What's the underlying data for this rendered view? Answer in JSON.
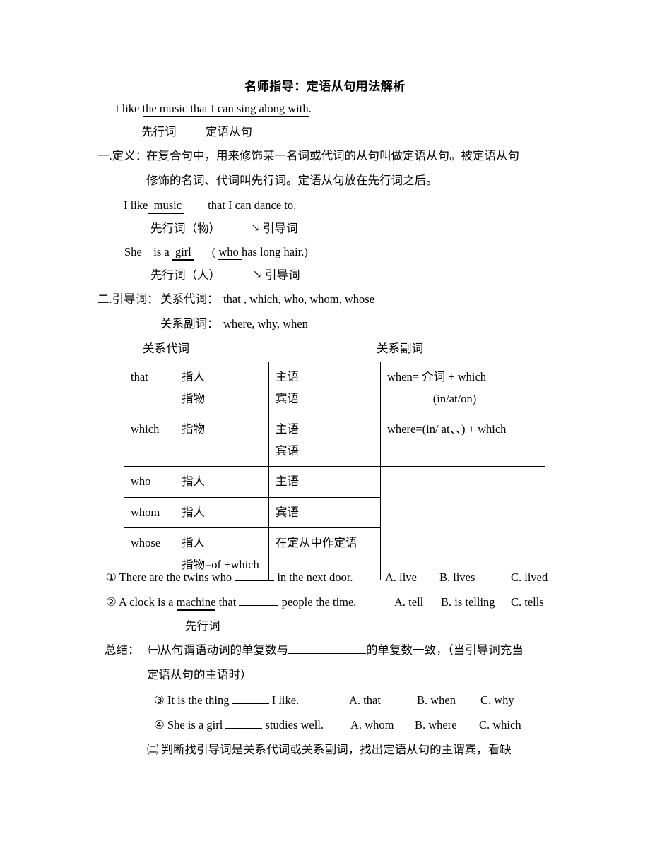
{
  "document": {
    "title": "名师指导：定语从句用法解析"
  },
  "example1": {
    "prefix": "I like ",
    "antecedent": "the music",
    "clause": " that I can sing along with",
    "period": ".",
    "label_antecedent": "先行词",
    "label_clause": "定语从句"
  },
  "definition": {
    "heading": "一.定义：",
    "line1": "在复合句中，用来修饰某一名词或代词的从句叫做定语从句。被定语从句",
    "line2": "修饰的名词、代词叫先行词。定语从句放在先行词之后。"
  },
  "example2": {
    "prefix": "I like",
    "antecedent": "  music ",
    "mid": "        ",
    "relword": "that",
    "rest": " I can dance to.",
    "label_antecedent": "先行词（物）",
    "arrow": "↘",
    "label_relword": "引导词"
  },
  "example3": {
    "prefix": "She    is a ",
    "antecedent": " girl ",
    "mid": "      ( ",
    "relword": "who ",
    "rest": "has long hair.)",
    "label_antecedent": "先行词（人）",
    "arrow": "↘",
    "label_relword": "引导词"
  },
  "guidewords": {
    "heading": "二.引导词：",
    "pronoun_label": "关系代词：",
    "pronoun_list": "that , which, who, whom, whose",
    "adverb_label": "关系副词：",
    "adverb_list": "where, why, when"
  },
  "table_headers": {
    "pronouns": "关系代词",
    "adverbs": "关系副词"
  },
  "table": {
    "rows": [
      {
        "word": "that",
        "refers_a": "指人",
        "refers_b": "指物",
        "role_a": "主语",
        "role_b": "宾语",
        "adverb_a": "when= 介词 + which",
        "adverb_b": "(in/at/on)"
      },
      {
        "word": "which",
        "refers_a": "指物",
        "refers_b": "",
        "role_a": "主语",
        "role_b": "宾语",
        "adverb_a": "where=(in/ at、、) + which",
        "adverb_b": ""
      },
      {
        "word": "who",
        "refers_a": "指人",
        "refers_b": "",
        "role_a": "主语",
        "role_b": "",
        "adverb_a": "",
        "adverb_b": ""
      },
      {
        "word": "whom",
        "refers_a": "指人",
        "refers_b": "",
        "role_a": "宾语",
        "role_b": "",
        "adverb_a": "",
        "adverb_b": ""
      },
      {
        "word": "whose",
        "refers_a": "指人",
        "refers_b": "指物=of +which",
        "role_a": "在定从中作定语",
        "role_b": "",
        "adverb_a": "",
        "adverb_b": ""
      }
    ]
  },
  "questions": {
    "q1": {
      "number": "①",
      "text_before": " There are the twins who ",
      "text_after": " in the next door.",
      "optA": "A. live",
      "optB": "B. lives",
      "optC": "C. lived"
    },
    "q2": {
      "number": "②",
      "text_before": " A clock is a ",
      "underlined": "machine",
      "text_mid": " that ",
      "text_after": " people the time.",
      "optA": "A. tell",
      "optB": "B. is telling",
      "optC": "C. tells",
      "label": "先行词"
    },
    "q3": {
      "number": "③",
      "text_before": " It is the thing ",
      "text_after": " I like.",
      "optA": "A. that",
      "optB": "B. when",
      "optC": "C. why"
    },
    "q4": {
      "number": "④",
      "text_before": " She is a girl ",
      "text_after": " studies well.",
      "optA": "A. whom",
      "optB": "B. where",
      "optC": "C. which"
    }
  },
  "summary": {
    "heading": "总结：",
    "item1_marker": "㈠",
    "item1_before": "从句谓语动词的单复数与",
    "item1_after": "的单复数一致，（当引导词充当",
    "item1_line2": "定语从句的主语时）",
    "item2_marker": "㈡",
    "item2_text": " 判断找引导词是关系代词或关系副词，找出定语从句的主谓宾，看缺"
  }
}
